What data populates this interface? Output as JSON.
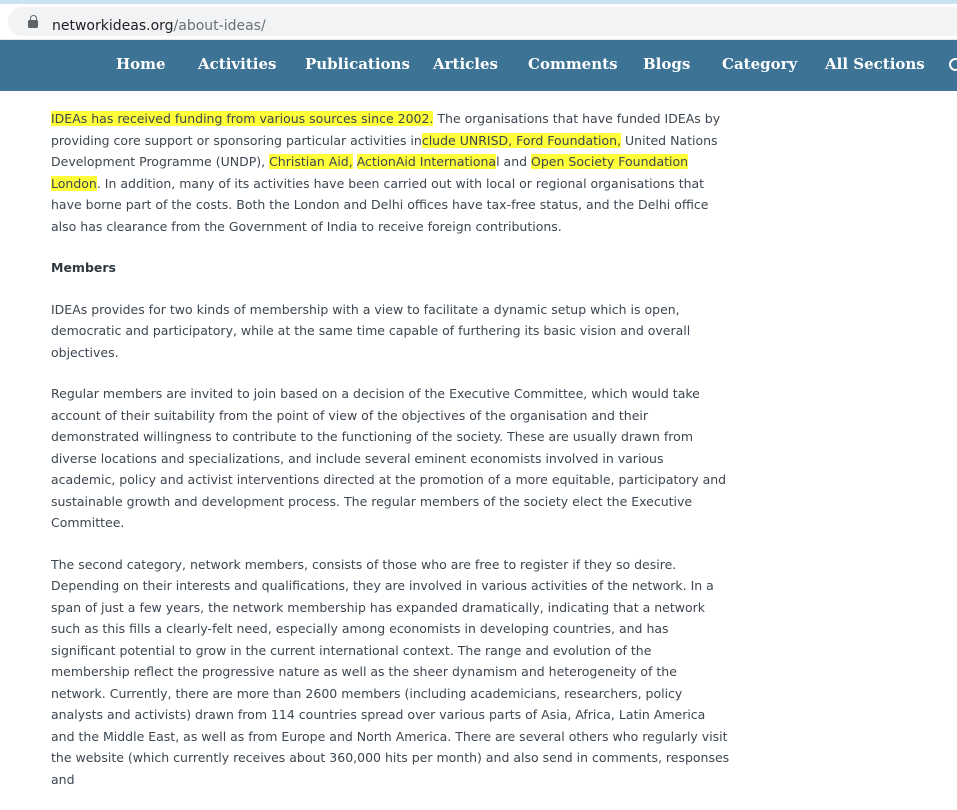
{
  "browser": {
    "url_host": "networkideas.org",
    "url_path": "/about-ideas/"
  },
  "nav": {
    "items": [
      "Home",
      "Activities",
      "Publications",
      "Articles",
      "Comments",
      "Blogs",
      "Category",
      "All Sections"
    ]
  },
  "content": {
    "funding": {
      "hl1": "IDEAs has received funding from various sources since 2002.",
      "t1": " The organisations that have funded IDEAs by providing core support or sponsoring particular activities in",
      "hl2": "clude UNRISD, Ford Foundation,",
      "t2": " United Nations Development Programme (UNDP), ",
      "hl3": "Christian Aid,",
      "t3": " ",
      "hl4": "ActionAid Internationa",
      "t4": "l and ",
      "hl5": "Open Society Foundation London",
      "t5": ". In addition, many of its activities have been carried out with local or regional organisations that have borne part of the costs. Both the London and Delhi offices have tax-free status, and the Delhi office also has clearance from the Government of India to receive foreign contributions."
    },
    "members_heading": "Members",
    "members_p1": "IDEAs provides for two kinds of membership with a view to facilitate a dynamic setup which is open, democratic and participatory, while at the same time capable of furthering its basic vision and overall objectives.",
    "members_p2": "Regular members are invited to join based on a decision of the Executive Committee, which would take account of their suitability from the point of view of the objectives of the organisation and their demonstrated willingness to contribute to the functioning of the society. These are usually drawn from diverse locations and specializations, and include several eminent economists involved in various academic, policy and activist interventions directed at the promotion of a more equitable, participatory and sustainable growth and development process. The regular members of the society elect the Executive Committee.",
    "members_p3": "The second category, network members, consists of those who are free to register if they so desire. Depending on their interests and qualifications, they are involved in various activities of the network. In a span of just a few years, the network membership has expanded dramatically, indicating that a network such as this fills a clearly-felt need, especially among economists in developing countries, and has significant potential to grow in the current international context. The range and evolution of the membership reflect the progressive nature as well as the sheer dynamism and heterogeneity of the network. Currently, there are more than 2600 members (including academicians, researchers, policy analysts and activists) drawn from 114 countries spread over various parts of Asia, Africa, Latin America and the Middle East, as well as from Europe and North America. There are several others who regularly visit the website (which currently receives about 360,000 hits per month) and also send in comments, responses and"
  },
  "colors": {
    "nav_bg": "#3d7395",
    "highlight": "#ffff3a",
    "text": "#3c4650"
  }
}
